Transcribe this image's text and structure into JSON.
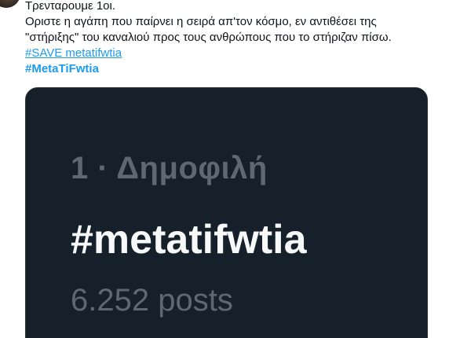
{
  "tweet": {
    "lines": [
      "Τρενταρουμε 1οι.",
      "Οριστε η αγάπη που παίρνει η σειρά απ'τον κόσμο, εν αντιθέσει  της",
      "\"στήριξης\" του καναλιού προς τους ανθρώπους που το στήριζαν πίσω."
    ],
    "hashtags": [
      "#SAVE metatifwtia",
      "#MetaTiFwtia"
    ]
  },
  "media": {
    "trend_meta": "1 · Δημοφιλή",
    "trend_name": "#metatifwtia",
    "trend_count": "6.252 posts"
  }
}
